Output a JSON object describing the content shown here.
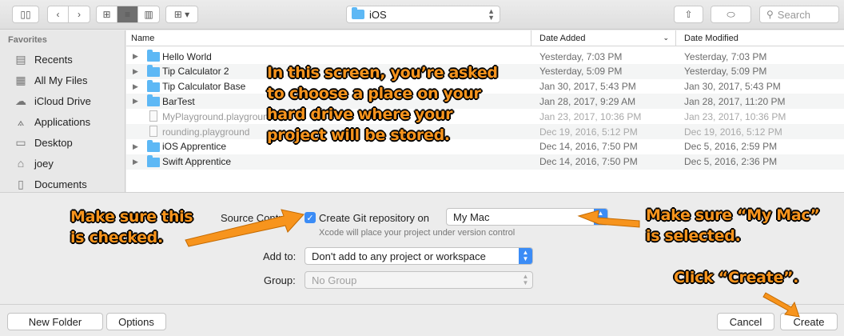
{
  "toolbar": {
    "location": "iOS",
    "search_placeholder": "Search"
  },
  "sidebar": {
    "heading": "Favorites",
    "items": [
      {
        "label": "Recents",
        "icon": "recents-icon",
        "glyph": "▤"
      },
      {
        "label": "All My Files",
        "icon": "all-files-icon",
        "glyph": "▦"
      },
      {
        "label": "iCloud Drive",
        "icon": "cloud-icon",
        "glyph": "☁"
      },
      {
        "label": "Applications",
        "icon": "applications-icon",
        "glyph": "⟑"
      },
      {
        "label": "Desktop",
        "icon": "desktop-icon",
        "glyph": "▭"
      },
      {
        "label": "joey",
        "icon": "home-icon",
        "glyph": "⌂"
      },
      {
        "label": "Documents",
        "icon": "documents-icon",
        "glyph": "▯"
      }
    ]
  },
  "filelist": {
    "columns": [
      "Name",
      "Date Added",
      "Date Modified"
    ],
    "rows": [
      {
        "name": "Hello World",
        "added": "Yesterday, 7:03 PM",
        "modified": "Yesterday, 7:03 PM",
        "kind": "folder"
      },
      {
        "name": "Tip Calculator 2",
        "added": "Yesterday, 5:09 PM",
        "modified": "Yesterday, 5:09 PM",
        "kind": "folder"
      },
      {
        "name": "Tip Calculator Base",
        "added": "Jan 30, 2017, 5:43 PM",
        "modified": "Jan 30, 2017, 5:43 PM",
        "kind": "folder"
      },
      {
        "name": "BarTest",
        "added": "Jan 28, 2017, 9:29 AM",
        "modified": "Jan 28, 2017, 11:20 PM",
        "kind": "folder"
      },
      {
        "name": "MyPlayground.playground",
        "added": "Jan 23, 2017, 10:36 PM",
        "modified": "Jan 23, 2017, 10:36 PM",
        "kind": "file"
      },
      {
        "name": "rounding.playground",
        "added": "Dec 19, 2016, 5:12 PM",
        "modified": "Dec 19, 2016, 5:12 PM",
        "kind": "file"
      },
      {
        "name": "iOS Apprentice",
        "added": "Dec 14, 2016, 7:50 PM",
        "modified": "Dec 5, 2016, 2:59 PM",
        "kind": "folder"
      },
      {
        "name": "Swift Apprentice",
        "added": "Dec 14, 2016, 7:50 PM",
        "modified": "Dec 5, 2016, 2:36 PM",
        "kind": "folder"
      }
    ]
  },
  "options": {
    "source_control_label": "Source Control:",
    "git_checkbox_label": "Create Git repository on",
    "git_checked": true,
    "git_target": "My Mac",
    "git_note": "Xcode will place your project under version control",
    "add_to_label": "Add to:",
    "add_to_value": "Don't add to any project or workspace",
    "group_label": "Group:",
    "group_value": "No Group"
  },
  "buttons": {
    "new_folder": "New Folder",
    "options": "Options",
    "cancel": "Cancel",
    "create": "Create"
  },
  "callouts": {
    "intro": "In this screen, you’re asked\nto choose a place on your\nhard drive where your\nproject will be stored.",
    "checked": "Make sure this\nis checked.",
    "my_mac": "Make sure “My Mac”\nis selected.",
    "create": "Click “Create”."
  },
  "colors": {
    "accent": "#3b8cf6",
    "callout": "#f7941d",
    "folder": "#5db8f5"
  }
}
